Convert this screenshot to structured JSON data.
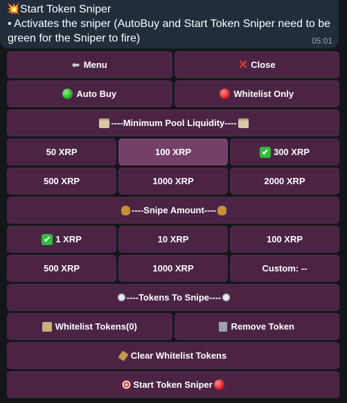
{
  "message": {
    "title": "💥Start Token Sniper",
    "body": "• Activates the sniper (AutoBuy and Start Token Sniper need to be green for the Sniper to fire)",
    "time": "05:01"
  },
  "keyboard": {
    "menu": "Menu",
    "close": "Close",
    "auto_buy": "Auto Buy",
    "whitelist_only": "Whitelist Only",
    "min_pool_header": "----Minimum Pool Liquidity----",
    "pool_options": [
      "50 XRP",
      "100 XRP",
      "300 XRP",
      "500 XRP",
      "1000 XRP",
      "2000 XRP"
    ],
    "snipe_header": "----Snipe Amount----",
    "snipe_options": [
      "1 XRP",
      "10 XRP",
      "100 XRP",
      "500 XRP",
      "1000 XRP",
      "Custom: --"
    ],
    "tokens_header": "----Tokens To Snipe----",
    "whitelist_tokens": "Whitelist Tokens(0)",
    "remove_token": "Remove Token",
    "clear_whitelist": "Clear Whitelist Tokens",
    "start_sniper": "Start Token Sniper"
  },
  "colors": {
    "button": "#4b2445",
    "button_highlight": "#74406a",
    "bubble": "#212d3b",
    "background": "#13171a"
  }
}
